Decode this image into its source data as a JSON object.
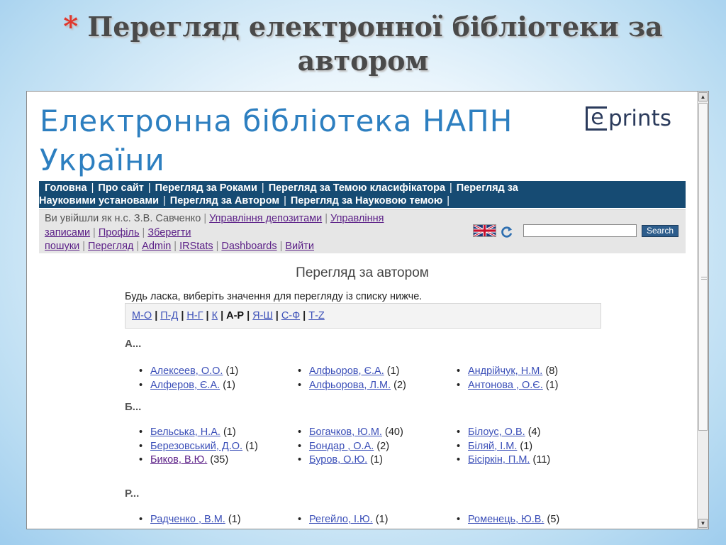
{
  "slide": {
    "title_line1": "Перегляд електронної бібліотеки за",
    "title_line2": "автором",
    "bullet": "*"
  },
  "site": {
    "title_line1": "Електронна бібліотека НАПН",
    "title_line2": "України",
    "logo_e": "e",
    "logo_rest": "prints"
  },
  "topnav": {
    "row1": [
      "Головна",
      "Про сайт",
      "Перегляд за Роками",
      "Перегляд за Темою класифікатора",
      "Перегляд за"
    ],
    "row2": [
      "Науковими установами",
      "Перегляд за Автором",
      "Перегляд за Науковою темою"
    ]
  },
  "userbar": {
    "logged_in": "Ви увійшли як н.с. З.В. Савченко",
    "links": {
      "deposits": "Управління депозитами",
      "manage_1": "Управління",
      "manage_2": "записами",
      "profile": "Профіль",
      "save_1": "Зберегти",
      "save_2": "пошуки",
      "review": "Перегляд",
      "admin": "Admin",
      "irstats": "IRStats",
      "dashboards": "Dashboards",
      "logout": "Вийти"
    },
    "search_placeholder": "",
    "search_button": "Search"
  },
  "browse": {
    "heading": "Перегляд за автором",
    "instructions": "Будь ласка, виберіть значення для перегляду із списку нижче.",
    "letters": [
      "М-О",
      "П-Д",
      "Н-Г",
      "К",
      "А-Р",
      "Я-Ш",
      "С-Ф",
      "Т-Z"
    ],
    "current_letter_index": 4,
    "sections": [
      {
        "head": "А...",
        "cols": [
          [
            {
              "name": "Алексеев, О.О.",
              "count": "(1)"
            },
            {
              "name": "Алферов, Є.А.",
              "count": "(1)"
            }
          ],
          [
            {
              "name": "Алфьоров, Є.А.",
              "count": "(1)"
            },
            {
              "name": "Алфьорова, Л.М.",
              "count": "(2)"
            }
          ],
          [
            {
              "name": "Андрійчук, Н.М.",
              "count": "(8)"
            },
            {
              "name": "Антонова , О.Є.",
              "count": "(1)"
            }
          ]
        ]
      },
      {
        "head": "Б...",
        "cols": [
          [
            {
              "name": "Бельська, Н.А.",
              "count": "(1)"
            },
            {
              "name": "Березовський, Д.О.",
              "count": "(1)"
            },
            {
              "name": "Биков, В.Ю.",
              "count": "(35)"
            }
          ],
          [
            {
              "name": "Богачков, Ю.М.",
              "count": "(40)"
            },
            {
              "name": "Бондар , О.А.",
              "count": "(2)"
            },
            {
              "name": "Буров, О.Ю.",
              "count": "(1)"
            }
          ],
          [
            {
              "name": "Білоус, О.В.",
              "count": "(4)"
            },
            {
              "name": "Біляй, І.М.",
              "count": "(1)"
            },
            {
              "name": "Бісіркін, П.М.",
              "count": "(11)"
            }
          ]
        ]
      },
      {
        "head": "Р...",
        "cols": [
          [
            {
              "name": "Радченко , В.М.",
              "count": "(1)"
            }
          ],
          [
            {
              "name": "Регейло, І.Ю.",
              "count": "(1)"
            }
          ],
          [
            {
              "name": "Роменець, Ю.В.",
              "count": "(5)"
            }
          ]
        ]
      }
    ]
  },
  "colors": {
    "nav_bg": "#164b73",
    "site_title": "#2d7fc0",
    "link": "#3b4fb8",
    "visited_link": "#5a1e86",
    "slide_bullet": "#e0362c"
  }
}
